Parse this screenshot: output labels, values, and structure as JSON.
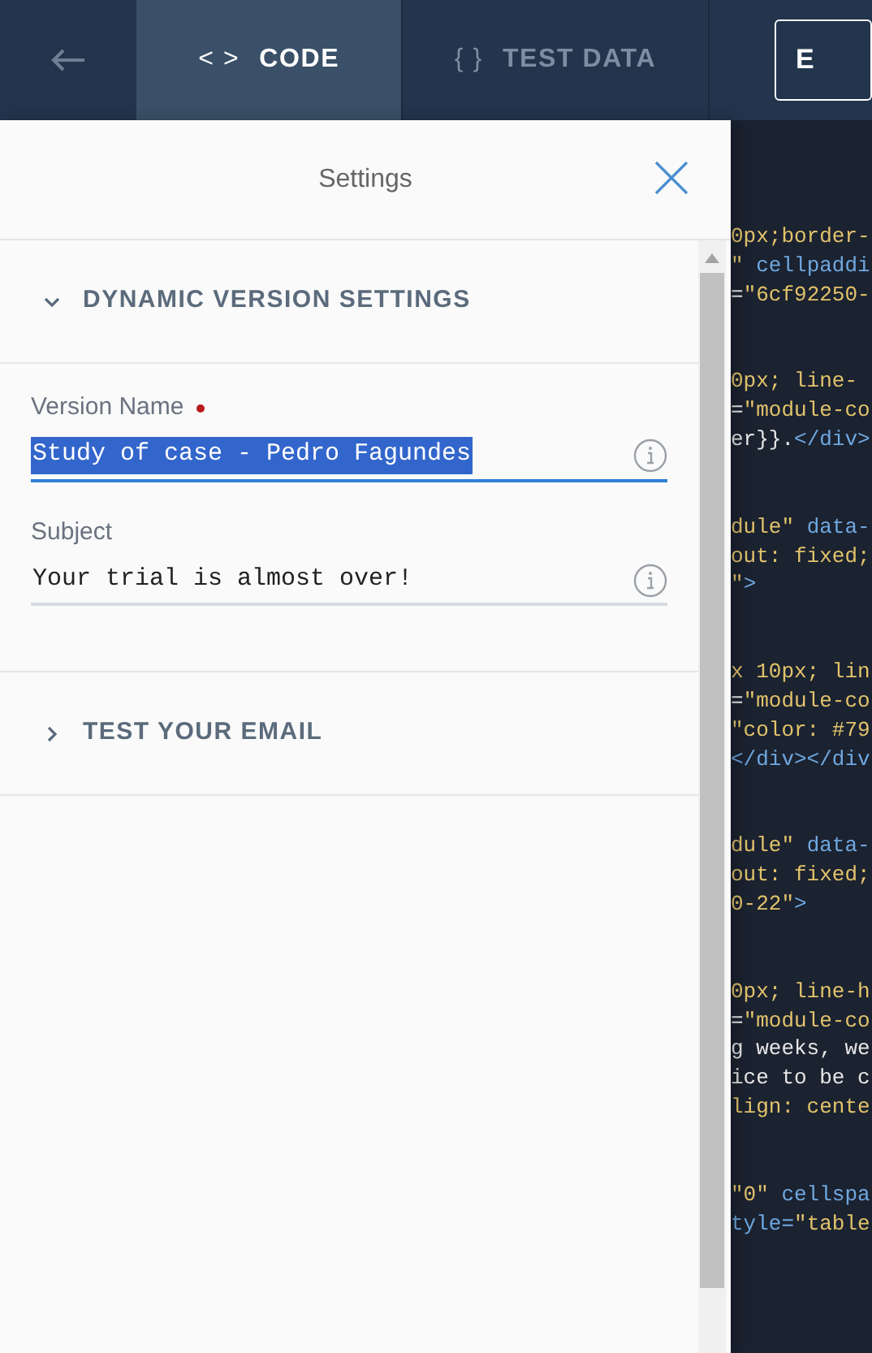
{
  "top_bar": {
    "tabs": [
      {
        "icon": "< >",
        "label": "CODE",
        "selected": true
      },
      {
        "icon": "{ }",
        "label": "TEST DATA",
        "selected": false
      }
    ],
    "button": "E"
  },
  "settings": {
    "title": "Settings",
    "sections": [
      {
        "title": "DYNAMIC VERSION SETTINGS",
        "expanded": true,
        "fields": [
          {
            "label": "Version Name",
            "required": true,
            "value": "Study of case - Pedro Fagundes",
            "focused": true
          },
          {
            "label": "Subject",
            "value": "Your trial is almost over!",
            "focused": false
          }
        ]
      },
      {
        "title": "TEST YOUR EMAIL",
        "expanded": false
      }
    ]
  },
  "code": {
    "blocks": [
      [
        [
          {
            "kind": "string",
            "text": "0px;border-"
          }
        ],
        [
          {
            "kind": "string",
            "text": "\""
          },
          {
            "kind": "attr",
            "text": " cellpaddi"
          }
        ],
        [
          {
            "kind": "plain",
            "text": "="
          },
          {
            "kind": "string",
            "text": "\"6cf92250-"
          }
        ]
      ],
      [
        [
          {
            "kind": "string",
            "text": "0px; line-"
          }
        ],
        [
          {
            "kind": "plain",
            "text": "="
          },
          {
            "kind": "string",
            "text": "\"module-co"
          }
        ],
        [
          {
            "kind": "plain",
            "text": "er}}."
          },
          {
            "kind": "attr",
            "text": "</div>"
          }
        ]
      ],
      [
        [
          {
            "kind": "string",
            "text": "dule\""
          },
          {
            "kind": "attr",
            "text": " data-"
          }
        ],
        [
          {
            "kind": "string",
            "text": "out: fixed;"
          }
        ],
        [
          {
            "kind": "string",
            "text": "\""
          },
          {
            "kind": "attr",
            "text": ">"
          }
        ]
      ],
      [
        [
          {
            "kind": "string",
            "text": "x 10px; lin"
          }
        ],
        [
          {
            "kind": "plain",
            "text": "="
          },
          {
            "kind": "string",
            "text": "\"module-co"
          }
        ],
        [
          {
            "kind": "string",
            "text": "\"color: #79"
          }
        ],
        [
          {
            "kind": "attr",
            "text": "</div></div"
          }
        ]
      ],
      [
        [
          {
            "kind": "string",
            "text": "dule\""
          },
          {
            "kind": "attr",
            "text": " data-"
          }
        ],
        [
          {
            "kind": "string",
            "text": "out: fixed;"
          }
        ],
        [
          {
            "kind": "string",
            "text": "0-22\""
          },
          {
            "kind": "attr",
            "text": ">"
          }
        ]
      ],
      [
        [
          {
            "kind": "string",
            "text": "0px; line-h"
          }
        ],
        [
          {
            "kind": "plain",
            "text": "="
          },
          {
            "kind": "string",
            "text": "\"module-co"
          }
        ],
        [
          {
            "kind": "plain",
            "text": "g weeks, we"
          }
        ],
        [
          {
            "kind": "plain",
            "text": "ice to be c"
          }
        ],
        [
          {
            "kind": "string",
            "text": "lign: cente"
          }
        ]
      ],
      [
        [
          {
            "kind": "string",
            "text": "\"0\""
          },
          {
            "kind": "attr",
            "text": " cellspa"
          }
        ],
        [
          {
            "kind": "attr",
            "text": "tyle="
          },
          {
            "kind": "string",
            "text": "\"table"
          }
        ]
      ]
    ]
  }
}
